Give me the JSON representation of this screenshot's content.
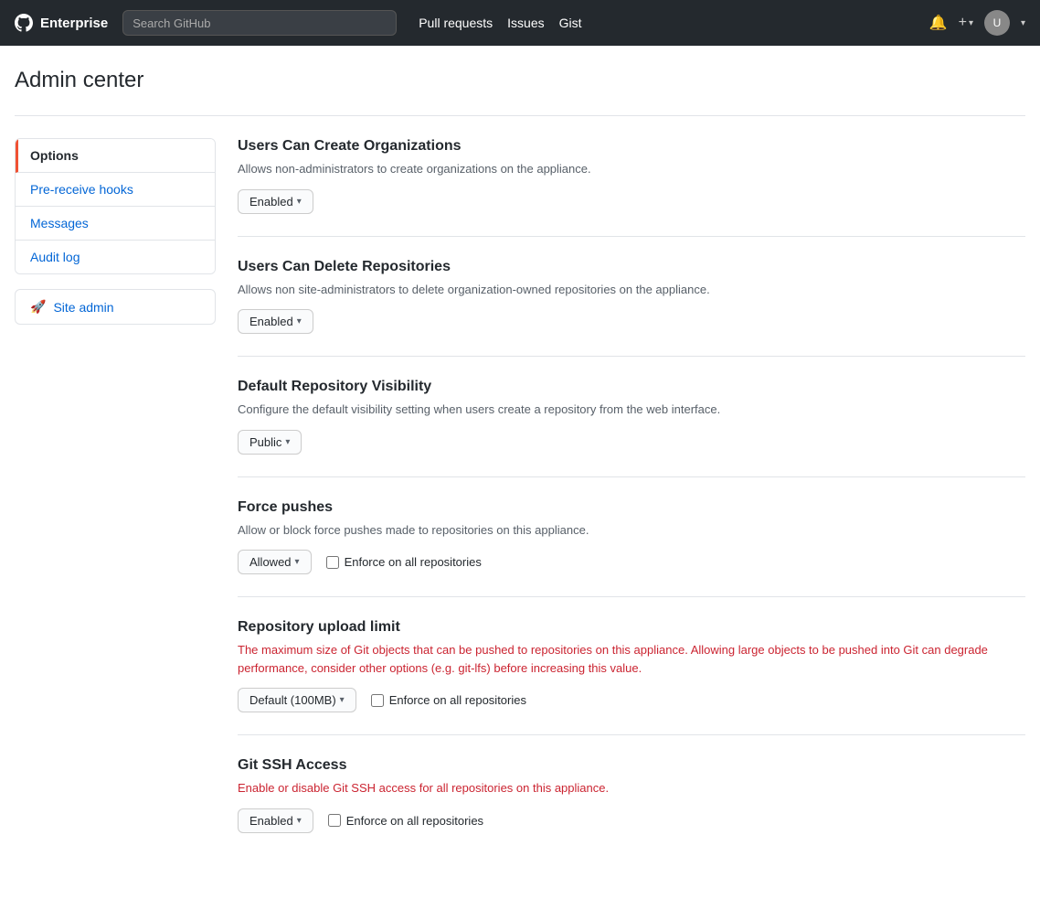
{
  "navbar": {
    "brand": "Enterprise",
    "search_placeholder": "Search GitHub",
    "links": [
      "Pull requests",
      "Issues",
      "Gist"
    ],
    "notification_icon": "bell",
    "add_icon": "+",
    "avatar_alt": "User avatar"
  },
  "page": {
    "title": "Admin center"
  },
  "sidebar": {
    "items": [
      {
        "label": "Options",
        "active": true
      },
      {
        "label": "Pre-receive hooks",
        "link": true
      },
      {
        "label": "Messages",
        "link": true
      },
      {
        "label": "Audit log",
        "link": true
      }
    ],
    "admin_item": {
      "label": "Site admin",
      "icon": "rocket"
    }
  },
  "settings": [
    {
      "id": "users-create-orgs",
      "title": "Users Can Create Organizations",
      "description": "Allows non-administrators to create organizations on the appliance.",
      "control_type": "dropdown",
      "control_value": "Enabled",
      "show_enforce": false
    },
    {
      "id": "users-delete-repos",
      "title": "Users Can Delete Repositories",
      "description": "Allows non site-administrators to delete organization-owned repositories on the appliance.",
      "control_type": "dropdown",
      "control_value": "Enabled",
      "show_enforce": false
    },
    {
      "id": "default-repo-visibility",
      "title": "Default Repository Visibility",
      "description": "Configure the default visibility setting when users create a repository from the web interface.",
      "control_type": "dropdown",
      "control_value": "Public",
      "show_enforce": false
    },
    {
      "id": "force-pushes",
      "title": "Force pushes",
      "description": "Allow or block force pushes made to repositories on this appliance.",
      "control_type": "dropdown",
      "control_value": "Allowed",
      "show_enforce": true,
      "enforce_label": "Enforce on all repositories"
    },
    {
      "id": "repo-upload-limit",
      "title": "Repository upload limit",
      "description": "The maximum size of Git objects that can be pushed to repositories on this appliance. Allowing large objects to be pushed into Git can degrade performance, consider other options (e.g. git-lfs) before increasing this value.",
      "desc_warning": true,
      "control_type": "dropdown",
      "control_value": "Default (100MB)",
      "show_enforce": true,
      "enforce_label": "Enforce on all repositories"
    },
    {
      "id": "git-ssh-access",
      "title": "Git SSH Access",
      "description": "Enable or disable Git SSH access for all repositories on this appliance.",
      "desc_warning": true,
      "control_type": "dropdown",
      "control_value": "Enabled",
      "show_enforce": true,
      "enforce_label": "Enforce on all repositories"
    }
  ]
}
